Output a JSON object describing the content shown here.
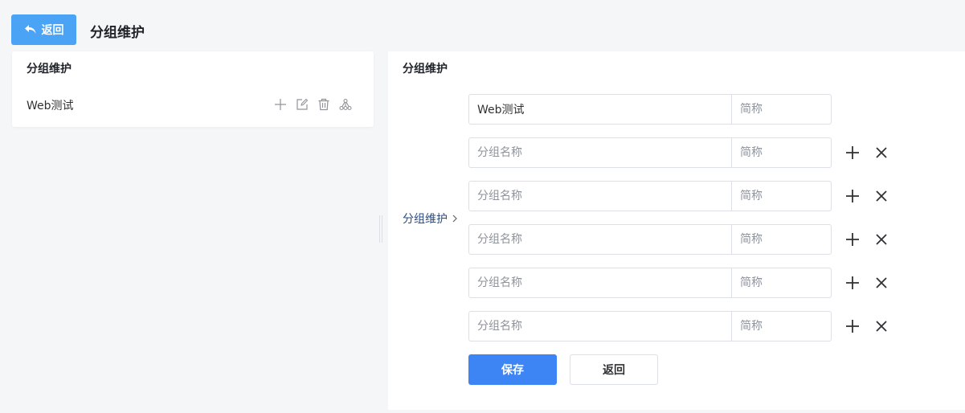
{
  "header": {
    "back_label": "返回",
    "title": "分组维护"
  },
  "left_panel": {
    "title": "分组维护",
    "tree": [
      {
        "label": "Web测试",
        "actions": [
          "add-icon",
          "edit-icon",
          "delete-icon",
          "hierarchy-icon"
        ]
      }
    ]
  },
  "right_panel": {
    "title": "分组维护",
    "group_label": "分组维护",
    "rows": [
      {
        "name_value": "Web测试",
        "name_placeholder": "分组名称",
        "short_value": "",
        "short_placeholder": "简称",
        "has_actions": false
      },
      {
        "name_value": "",
        "name_placeholder": "分组名称",
        "short_value": "",
        "short_placeholder": "简称",
        "has_actions": true
      },
      {
        "name_value": "",
        "name_placeholder": "分组名称",
        "short_value": "",
        "short_placeholder": "简称",
        "has_actions": true
      },
      {
        "name_value": "",
        "name_placeholder": "分组名称",
        "short_value": "",
        "short_placeholder": "简称",
        "has_actions": true
      },
      {
        "name_value": "",
        "name_placeholder": "分组名称",
        "short_value": "",
        "short_placeholder": "简称",
        "has_actions": true
      },
      {
        "name_value": "",
        "name_placeholder": "分组名称",
        "short_value": "",
        "short_placeholder": "简称",
        "has_actions": true
      }
    ],
    "save_label": "保存",
    "back_label": "返回"
  },
  "colors": {
    "primary": "#3d85f5",
    "back_button": "#4aa3f5",
    "group_label": "#2b4a7e"
  }
}
